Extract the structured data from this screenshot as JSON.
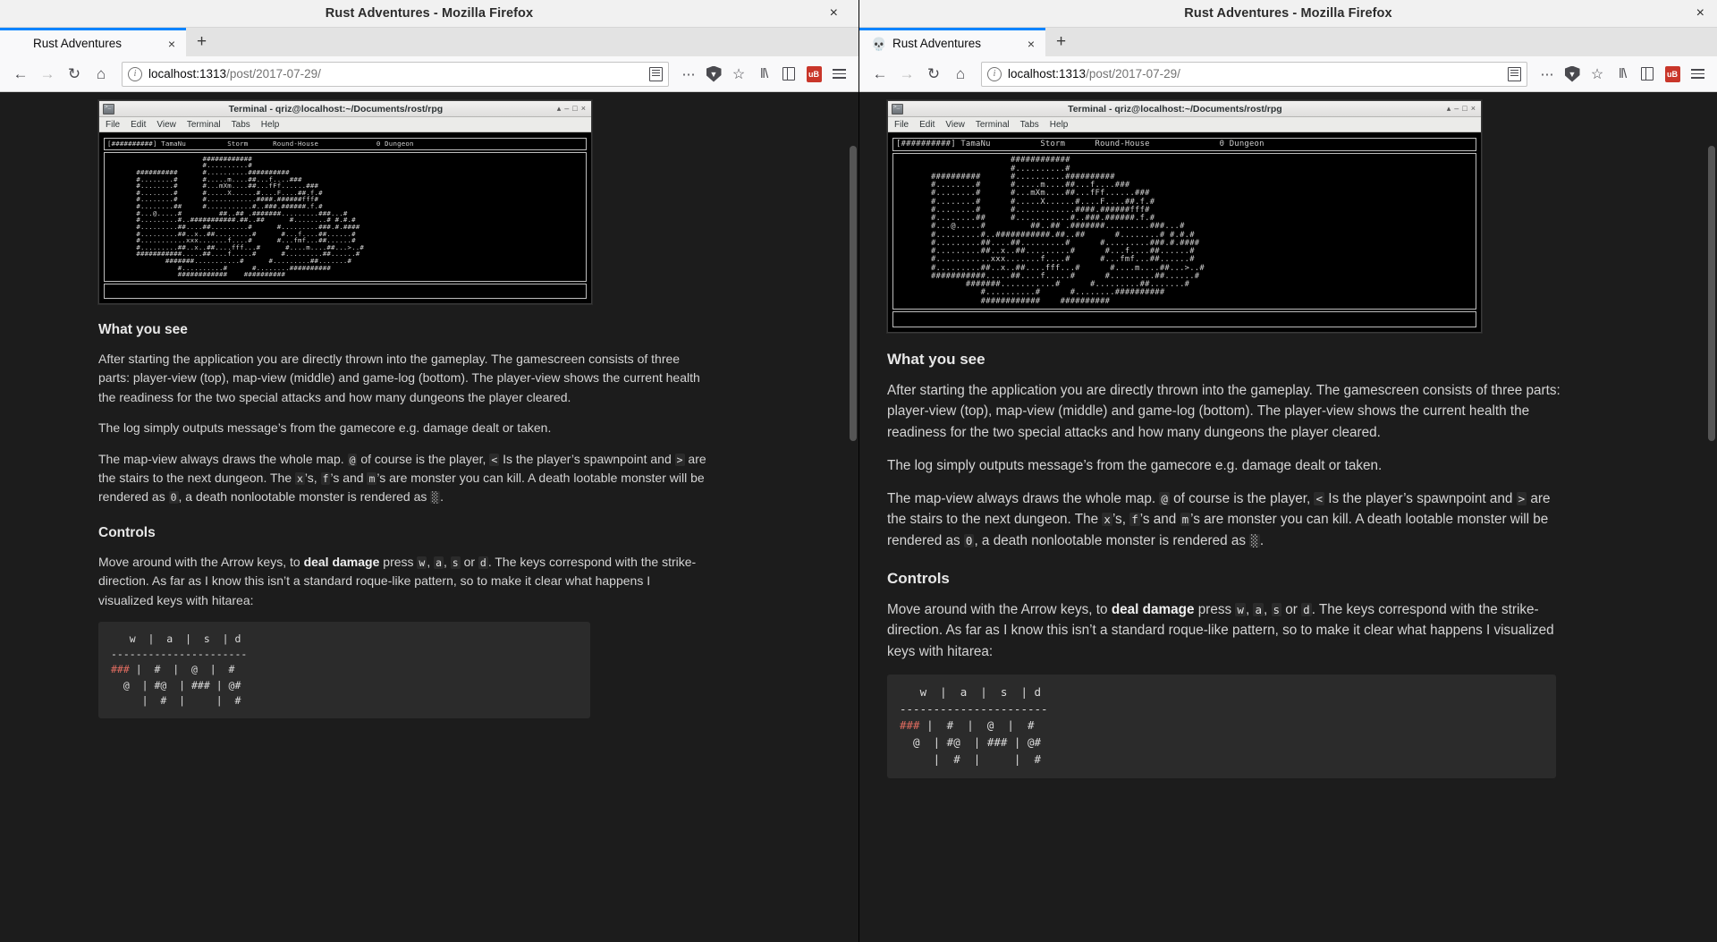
{
  "windows": [
    {
      "id": "left",
      "title": "Rust Adventures - Mozilla Firefox",
      "close_label": "×",
      "tab": {
        "label": "Rust Adventures",
        "close": "×",
        "favicon": ""
      },
      "newtab_label": "+",
      "nav": {
        "back": "←",
        "forward": "→",
        "reload": "↻",
        "home": "⌂",
        "library": "‖\\",
        "sidebar": "sidebar-icon",
        "ublock": "uB",
        "menu": "hamburger-icon"
      },
      "url": {
        "info": "i",
        "host": "localhost:1313",
        "rest": "/post/2017-07-29/",
        "full": "localhost:1313/post/2017-07-29/"
      }
    },
    {
      "id": "right",
      "title": "Rust Adventures - Mozilla Firefox",
      "close_label": "×",
      "tab": {
        "label": "Rust Adventures",
        "close": "×",
        "favicon": "💀"
      },
      "newtab_label": "+",
      "nav": {
        "back": "←",
        "forward": "→",
        "reload": "↻",
        "home": "⌂",
        "library": "‖\\",
        "sidebar": "sidebar-icon",
        "ublock": "uB",
        "menu": "hamburger-icon"
      },
      "url": {
        "info": "i",
        "host": "localhost:1313",
        "rest": "/post/2017-07-29/",
        "full": "localhost:1313/post/2017-07-29/"
      }
    }
  ],
  "terminal": {
    "title": "Terminal - qriz@localhost:~/Documents/rost/rpg",
    "window_buttons": [
      "▴",
      "–",
      "□",
      "×"
    ],
    "menu": [
      "File",
      "Edit",
      "View",
      "Terminal",
      "Tabs",
      "Help"
    ],
    "statusline": "[##########] TamaNu          Storm      Round-House              0 Dungeon",
    "map": "                       ############\n                       #..........#\n       ##########      #..........##########\n       #........#      #.....m....##...f....###\n       #........#      #...mXm....##...fFf......###\n       #........#      #.....X......#....F....##.f.#\n       #........#      #............####.######fff#\n       #........##     #...........#..###.######.f.#\n       #...@.....#         ##..## .#######.........###...#\n       #.........#..###########.##..##      #........# #.#.#\n       #.........##....##.........#      #.........###.#.####\n       #.........##..x..##.........#      #...f....##......#\n       #...........xxx.......f....#      #...fmf...##......#\n       #.........##..x..##....fff...#      #....m....##...>..#\n       ###########.....##....f.....#      #.........##......#\n              #######...........#      #.........##.......#\n                 #..........#      #........##########\n                 ############    ##########",
    "scrollbar": true
  },
  "article": {
    "sections": [
      {
        "heading": "What you see",
        "paragraphs": [
          "After starting the application you are directly thrown into the gameplay. The gamescreen consists of three parts: player-view (top), map-view (middle) and game-log (bottom). The player-view shows the current health the readiness for the two special attacks and how many dungeons the player cleared.",
          "The log simply outputs message’s from the gamecore e.g. damage dealt or taken."
        ]
      },
      {
        "heading": "Controls"
      }
    ],
    "map_paragraph": {
      "p1": "The map-view always draws the whole map. ",
      "c1": "@",
      "p2": " of course is the player, ",
      "c2": "<",
      "p3": " Is the player’s spawnpoint and ",
      "c3": ">",
      "p4": " are the stairs to the next dungeon. The ",
      "c4": "x",
      "p5": "’s, ",
      "c5": "f",
      "p6": "’s and ",
      "c6": "m",
      "p7": "’s are monster you can kill. A death lootable monster will be rendered as ",
      "c7": "0",
      "p8": ", a death nonlootable monster is rendered as ",
      "c8": "░",
      "p9": "."
    },
    "controls_paragraph": {
      "p1": "Move around with the Arrow keys, to ",
      "bold": "deal damage",
      "p2": " press ",
      "c1": "w",
      "p3": ", ",
      "c2": "a",
      "p4": ", ",
      "c3": "s",
      "p5": " or ",
      "c4": "d",
      "p6": ". The keys correspond with the strike-direction. As far as I know this isn’t a standard roque-like pattern, so to make it clear what happens I visualized keys with hitarea:"
    },
    "hitarea_code": {
      "line1": "   w  |  a  |  s  | d",
      "line2": "----------------------",
      "line3_red": "###",
      "line3_rest": " |  #  |  @  |  #",
      "line4": "  @  | #@  | ### | @#",
      "line5": "     |  #  |     |  #"
    }
  }
}
